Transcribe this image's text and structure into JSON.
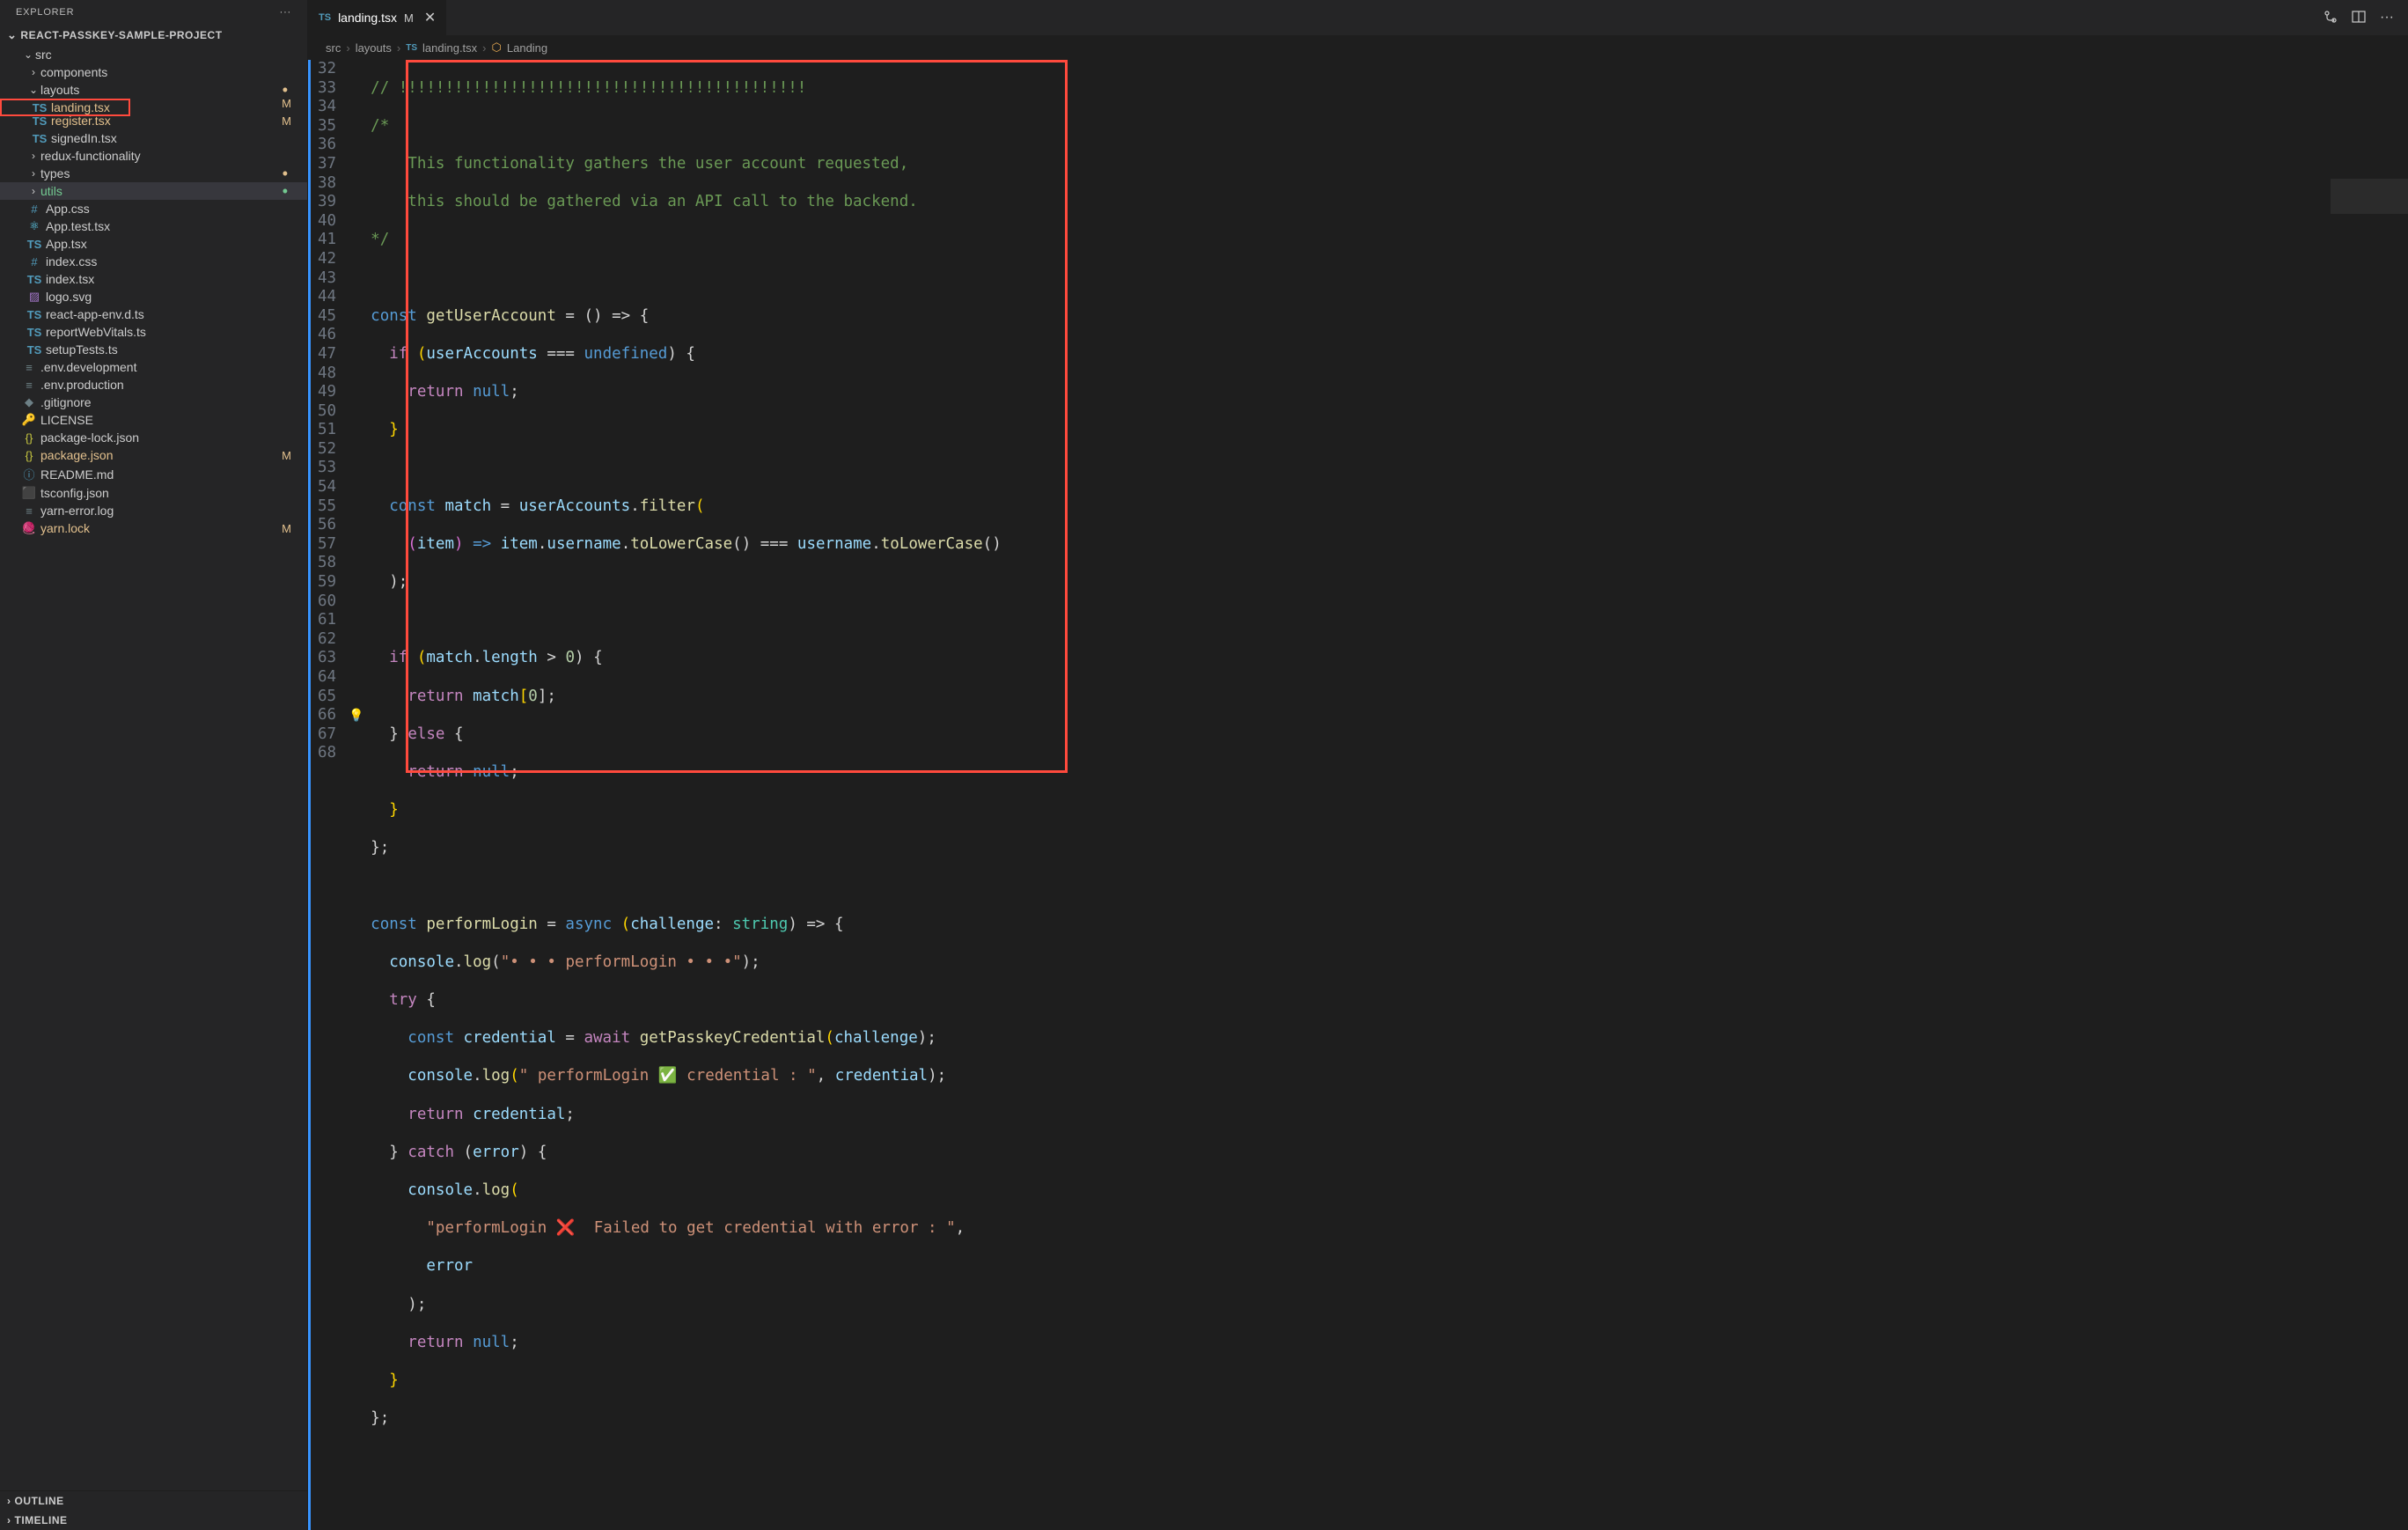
{
  "sidebar": {
    "title": "EXPLORER",
    "project": "REACT-PASSKEY-SAMPLE-PROJECT",
    "outline": "OUTLINE",
    "timeline": "TIMELINE"
  },
  "tree": {
    "src": "src",
    "components": "components",
    "layouts": "layouts",
    "landing": "landing.tsx",
    "register": "register.tsx",
    "signedIn": "signedIn.tsx",
    "redux": "redux-functionality",
    "types": "types",
    "utils": "utils",
    "appcss": "App.css",
    "apptest": "App.test.tsx",
    "apptsx": "App.tsx",
    "indexcss": "index.css",
    "indextsx": "index.tsx",
    "logosvg": "logo.svg",
    "reactenv": "react-app-env.d.ts",
    "reportweb": "reportWebVitals.ts",
    "setuptests": "setupTests.ts",
    "envdev": ".env.development",
    "envprod": ".env.production",
    "gitignore": ".gitignore",
    "license": "LICENSE",
    "pkglock": "package-lock.json",
    "pkgjson": "package.json",
    "readme": "README.md",
    "tsconfig": "tsconfig.json",
    "yarnerr": "yarn-error.log",
    "yarnlock": "yarn.lock",
    "M": "M"
  },
  "tab": {
    "label": "landing.tsx",
    "modified": "M"
  },
  "breadcrumb": {
    "src": "src",
    "layouts": "layouts",
    "file": "landing.tsx",
    "symbol": "Landing"
  },
  "code": {
    "lines": [
      32,
      33,
      34,
      35,
      36,
      37,
      38,
      39,
      40,
      41,
      42,
      43,
      44,
      45,
      46,
      47,
      48,
      49,
      50,
      51,
      52,
      53,
      54,
      55,
      56,
      57,
      58,
      59,
      60,
      61,
      62,
      63,
      64,
      65,
      66,
      67,
      68
    ],
    "l32": "// !!!!!!!!!!!!!!!!!!!!!!!!!!!!!!!!!!!!!!!!!!!!",
    "l33": "/*",
    "l34": "    This functionality gathers the user account requested,",
    "l35": "    this should be gathered via an API call to the backend.",
    "l36": "*/",
    "l38_const": "const ",
    "l38_fn": "getUserAccount",
    "l38_rest": " = () => {",
    "l39_if": "if ",
    "l39_open": "(",
    "l39_var": "userAccounts",
    "l39_eq": " === ",
    "l39_undef": "undefined",
    "l39_close": ") {",
    "l40_ret": "return ",
    "l40_null": "null",
    "l40_semi": ";",
    "l41_brace": "}",
    "l43_const": "const ",
    "l43_var": "match",
    "l43_eq": " = ",
    "l43_ua": "userAccounts",
    "l43_dot": ".",
    "l43_filter": "filter",
    "l43_open": "(",
    "l44_open": "(",
    "l44_item": "item",
    "l44_close": ")",
    "l44_arrow": " => ",
    "l44_item2": "item",
    "l44_dot": ".",
    "l44_un": "username",
    "l44_tl": "toLowerCase",
    "l44_par": "() === ",
    "l44_un2": "username",
    "l44_tl2": "toLowerCase",
    "l44_end": "()",
    "l45_close": ");",
    "l47_if": "if ",
    "l47_open": "(",
    "l47_match": "match",
    "l47_len": "length",
    "l47_gt": " > ",
    "l47_zero": "0",
    "l47_close": ") {",
    "l48_ret": "return ",
    "l48_match": "match",
    "l48_idx": "[",
    "l48_zero": "0",
    "l48_idxc": "];",
    "l49_else": "} ",
    "l49_kw": "else",
    "l49_brace": " {",
    "l50_ret": "return ",
    "l50_null": "null",
    "l50_semi": ";",
    "l51_brace": "}",
    "l52_close": "};",
    "l54_const": "const ",
    "l54_fn": "performLogin",
    "l54_eq": " = ",
    "l54_async": "async ",
    "l54_open": "(",
    "l54_param": "challenge",
    "l54_colon": ": ",
    "l54_type": "string",
    "l54_close": ") => {",
    "l55_console": "console",
    "l55_log": "log",
    "l55_str": "\"• • • performLogin • • •\"",
    "l55_end": ");",
    "l56_try": "try",
    "l56_brace": " {",
    "l57_const": "const ",
    "l57_cred": "credential",
    "l57_eq": " = ",
    "l57_await": "await ",
    "l57_fn": "getPasskeyCredential",
    "l57_open": "(",
    "l57_chal": "challenge",
    "l57_close": ");",
    "l58_console": "console",
    "l58_log": "log",
    "l58_open": "(",
    "l58_str": "\" performLogin ✅ credential : \"",
    "l58_comma": ", ",
    "l58_cred": "credential",
    "l58_close": ");",
    "l59_ret": "return ",
    "l59_cred": "credential",
    "l59_semi": ";",
    "l60_brace": "} ",
    "l60_catch": "catch",
    "l60_open": " (",
    "l60_err": "error",
    "l60_close": ") {",
    "l61_console": "console",
    "l61_log": "log",
    "l61_open": "(",
    "l62_str": "\"performLogin ❌  Failed to get credential with error : \"",
    "l62_comma": ",",
    "l63_err": "error",
    "l64_close": ");",
    "l65_ret": "return ",
    "l65_null": "null",
    "l65_semi": ";",
    "l66_brace": "}",
    "l67_close": "};"
  }
}
